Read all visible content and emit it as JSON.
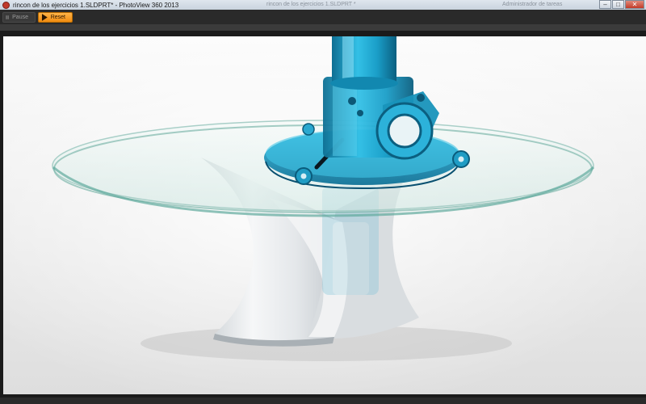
{
  "window": {
    "title": "rincon de los ejercicios 1.SLDPRT* - PhotoView 360 2013",
    "ghost_left": "rincon de los ejercicios 1.SLDPRT *",
    "ghost_right": "Administrador de tareas"
  },
  "window_controls": {
    "minimize": "–",
    "maximize": "□",
    "close": "✕"
  },
  "toolbar": {
    "pause_label": "Pause",
    "reset_label": "Reset"
  },
  "colors": {
    "accent": "#f7a11a",
    "titlebar": "#d6dde6",
    "toolbar": "#2a2a2a",
    "part_blue": "#1aa3cc"
  },
  "icons": [
    "app-icon",
    "pause-icon",
    "play-icon"
  ]
}
